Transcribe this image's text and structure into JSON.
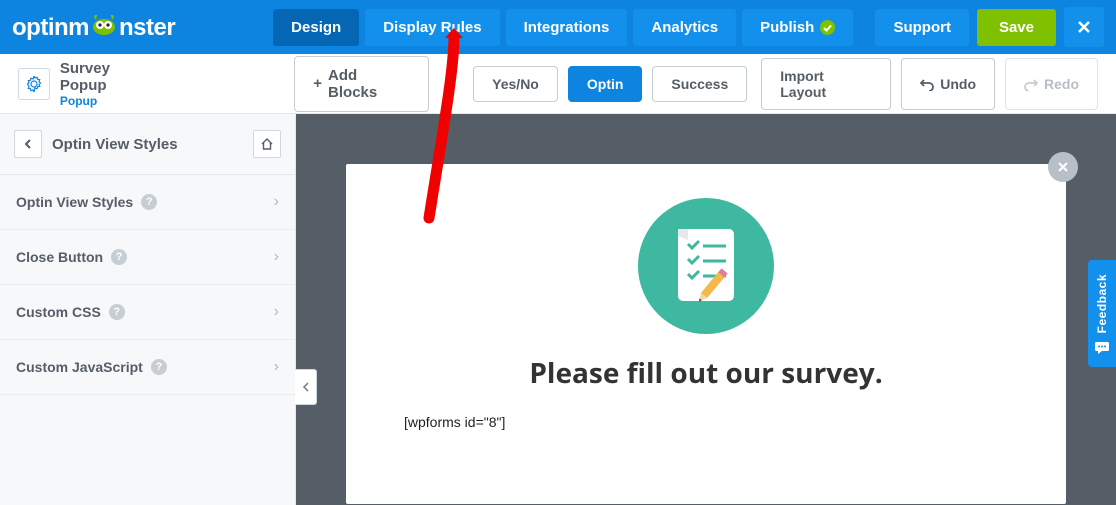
{
  "brand": "optinmonster",
  "nav": {
    "design": "Design",
    "display_rules": "Display Rules",
    "integrations": "Integrations",
    "analytics": "Analytics",
    "publish": "Publish",
    "support": "Support"
  },
  "actions": {
    "save": "Save"
  },
  "campaign": {
    "title": "Survey Popup",
    "type": "Popup"
  },
  "toolbar": {
    "add_blocks": "Add Blocks",
    "yes_no": "Yes/No",
    "optin": "Optin",
    "success": "Success",
    "import_layout": "Import Layout",
    "undo": "Undo",
    "redo": "Redo"
  },
  "sidebar": {
    "header": "Optin View Styles",
    "items": [
      {
        "label": "Optin View Styles"
      },
      {
        "label": "Close Button"
      },
      {
        "label": "Custom CSS"
      },
      {
        "label": "Custom JavaScript"
      }
    ]
  },
  "popup": {
    "headline": "Please fill out our survey.",
    "shortcode": "[wpforms id=\"8\"]"
  },
  "feedback": "Feedback"
}
